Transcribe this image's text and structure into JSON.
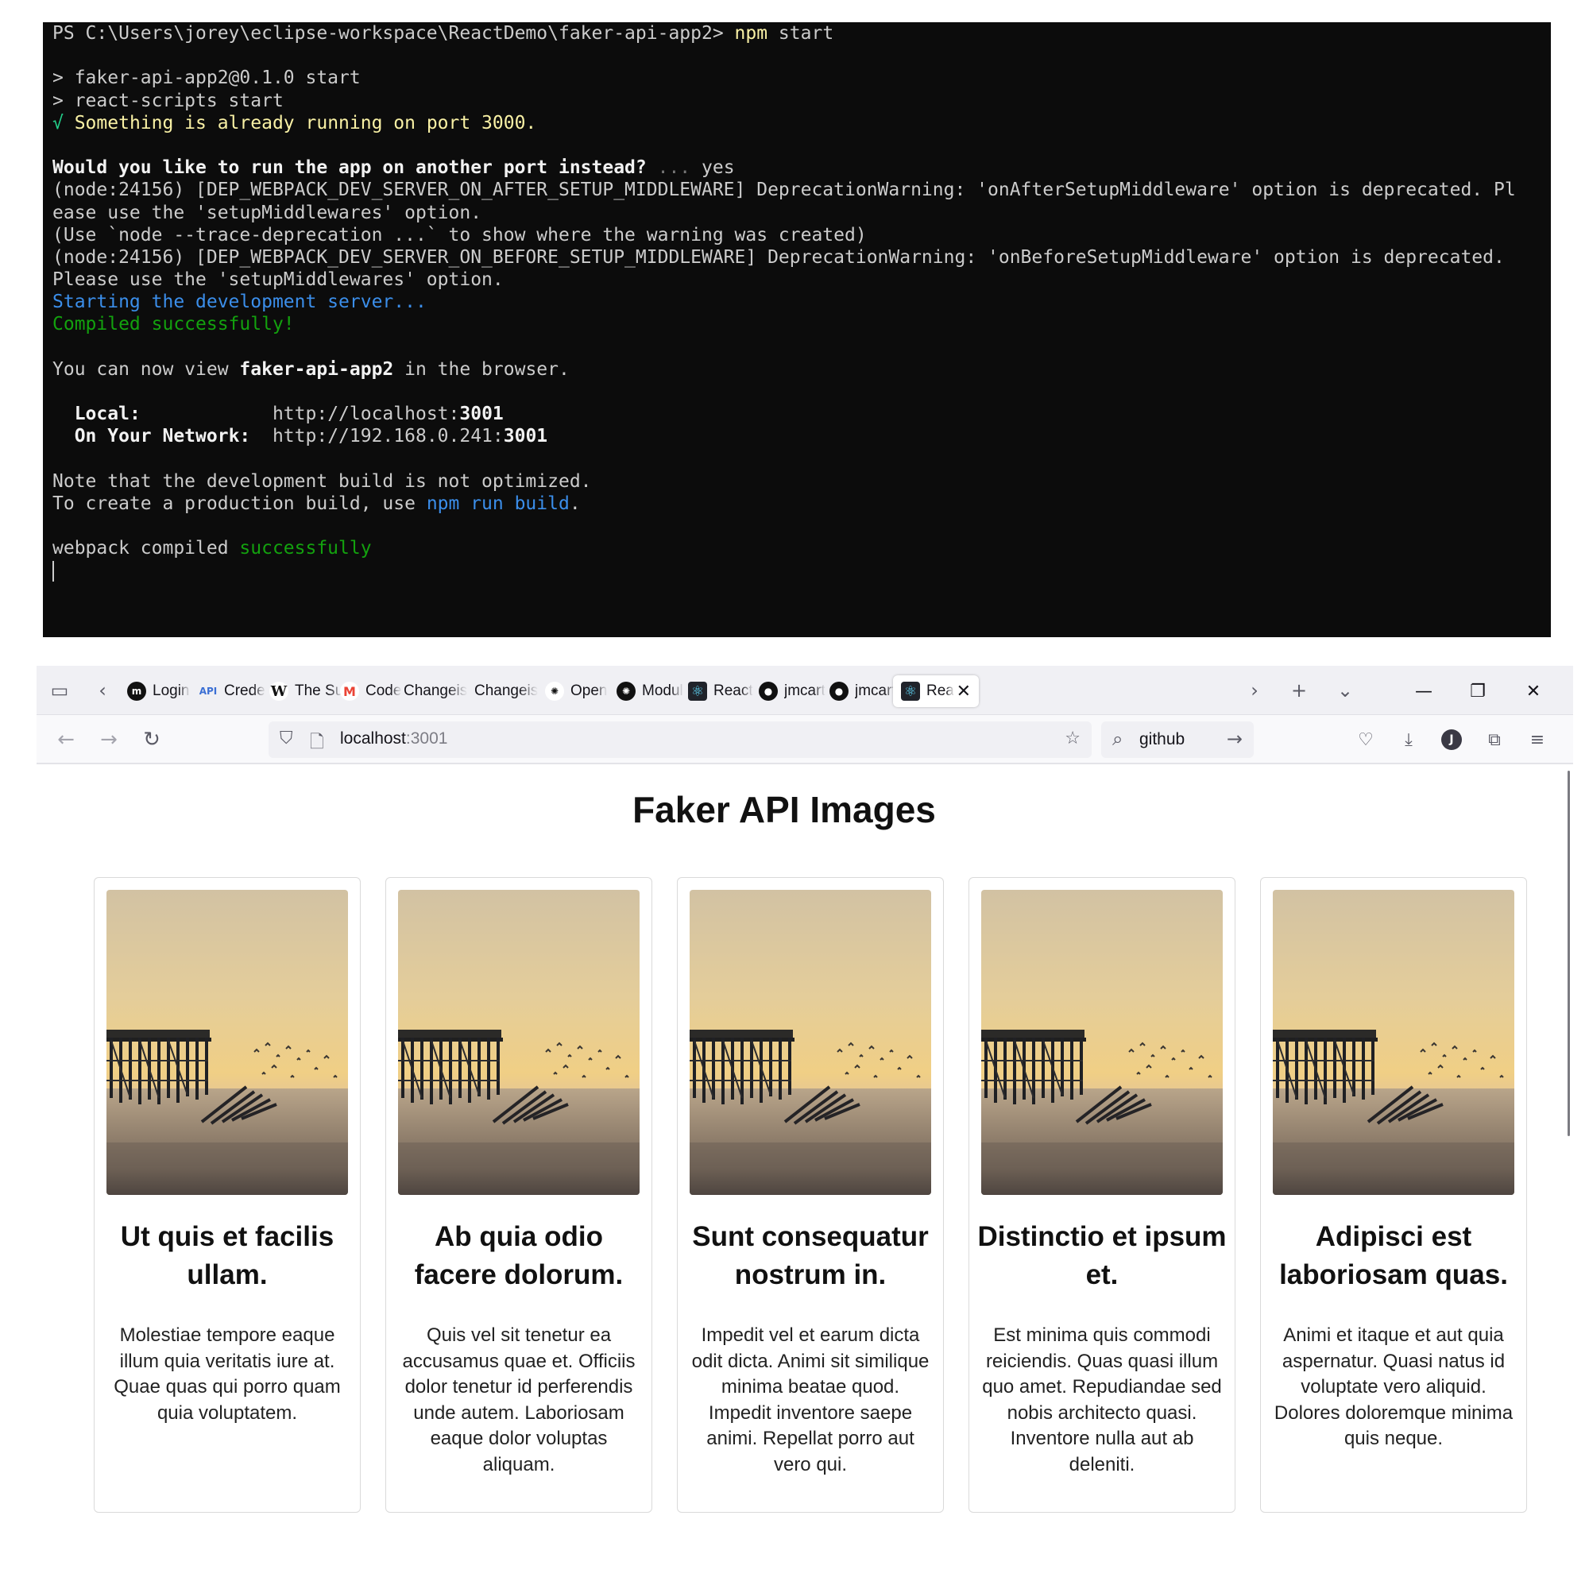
{
  "terminal": {
    "lines": [
      [
        {
          "t": "PS C:\\Users\\jorey\\eclipse-workspace\\ReactDemo\\faker-api-app2> "
        },
        {
          "t": "npm",
          "c": "c-yellow"
        },
        {
          "t": " start"
        }
      ],
      [],
      [
        {
          "t": "> faker-api-app2@0.1.0 start"
        }
      ],
      [
        {
          "t": "> react-scripts start"
        }
      ],
      [
        {
          "t": "√ ",
          "c": "c-green"
        },
        {
          "t": "Something is already running on port 3000.",
          "c": "c-yellow"
        }
      ],
      [],
      [
        {
          "t": "Would you like to run the app on another port instead?",
          "c": "c-white"
        },
        {
          "t": " ... ",
          "c": "c-dim"
        },
        {
          "t": "yes"
        }
      ],
      [
        {
          "t": "(node:24156) [DEP_WEBPACK_DEV_SERVER_ON_AFTER_SETUP_MIDDLEWARE] DeprecationWarning: 'onAfterSetupMiddleware' option is deprecated. Pl"
        }
      ],
      [
        {
          "t": "ease use the 'setupMiddlewares' option."
        }
      ],
      [
        {
          "t": "(Use `node --trace-deprecation ...` to show where the warning was created)"
        }
      ],
      [
        {
          "t": "(node:24156) [DEP_WEBPACK_DEV_SERVER_ON_BEFORE_SETUP_MIDDLEWARE] DeprecationWarning: 'onBeforeSetupMiddleware' option is deprecated."
        }
      ],
      [
        {
          "t": "Please use the 'setupMiddlewares' option."
        }
      ],
      [
        {
          "t": "Starting the development server...",
          "c": "c-blue"
        }
      ],
      [
        {
          "t": "Compiled successfully!",
          "c": "c-green2"
        }
      ],
      [],
      [
        {
          "t": "You can now view "
        },
        {
          "t": "faker-api-app2",
          "c": "c-white"
        },
        {
          "t": " in the browser."
        }
      ],
      [],
      [
        {
          "t": "  "
        },
        {
          "t": "Local:",
          "c": "c-white"
        },
        {
          "t": "            http://localhost:"
        },
        {
          "t": "3001",
          "c": "c-white"
        }
      ],
      [
        {
          "t": "  "
        },
        {
          "t": "On Your Network:",
          "c": "c-white"
        },
        {
          "t": "  http://192.168.0.241:"
        },
        {
          "t": "3001",
          "c": "c-white"
        }
      ],
      [],
      [
        {
          "t": "Note that the development build is not optimized."
        }
      ],
      [
        {
          "t": "To create a production build, use "
        },
        {
          "t": "npm run build",
          "c": "c-blue"
        },
        {
          "t": "."
        }
      ],
      [],
      [
        {
          "t": "webpack compiled "
        },
        {
          "t": "successfully",
          "c": "c-green2"
        }
      ]
    ]
  },
  "browser": {
    "tabs": [
      {
        "label": "Login",
        "icon": "m-logo-icon",
        "glyph": "m",
        "color": "#111111"
      },
      {
        "label": "Crede",
        "icon": "api-icon",
        "glyph": "API",
        "color": "#3b6fd4"
      },
      {
        "label": "The Su",
        "icon": "wikipedia-icon",
        "glyph": "W",
        "color": "#ffffff"
      },
      {
        "label": "Code",
        "icon": "gmail-icon",
        "glyph": "M",
        "color": "#ea4335"
      },
      {
        "label": "Changeis",
        "icon": "",
        "glyph": "",
        "color": ""
      },
      {
        "label": "Changeis",
        "icon": "",
        "glyph": "",
        "color": ""
      },
      {
        "label": "Open",
        "icon": "openai-icon",
        "glyph": "✺",
        "color": "#ffffff"
      },
      {
        "label": "Modul",
        "icon": "openai-icon",
        "glyph": "✺",
        "color": "#111111"
      },
      {
        "label": "React",
        "icon": "react-icon",
        "glyph": "⚛",
        "color": "#20232a"
      },
      {
        "label": "jmcart",
        "icon": "github-icon",
        "glyph": "●",
        "color": "#111111"
      },
      {
        "label": "jmcart",
        "icon": "github-icon",
        "glyph": "●",
        "color": "#111111"
      },
      {
        "label": "Rea",
        "icon": "react-icon",
        "glyph": "⚛",
        "color": "#20232a",
        "active": true
      }
    ],
    "url_host": "localhost",
    "url_port": ":3001",
    "search_text": "github"
  },
  "page": {
    "title": "Faker API Images",
    "cards": [
      {
        "title": "Ut quis et facilis ullam.",
        "body": "Molestiae tempore eaque illum quia veritatis iure at. Quae quas qui porro quam quia voluptatem."
      },
      {
        "title": "Ab quia odio facere dolorum.",
        "body": "Quis vel sit tenetur ea accusamus quae et. Officiis dolor tenetur id perferendis unde autem. Laboriosam eaque dolor voluptas aliquam."
      },
      {
        "title": "Sunt consequatur nostrum in.",
        "body": "Impedit vel et earum dicta odit dicta. Animi sit similique minima beatae quod. Impedit inventore saepe animi. Repellat porro aut vero qui."
      },
      {
        "title": "Distinctio et ipsum et.",
        "body": "Est minima quis commodi reiciendis. Quas quasi illum quo amet. Repudiandae sed nobis architecto quasi. Inventore nulla aut ab deleniti."
      },
      {
        "title": "Adipisci est laboriosam quas.",
        "body": "Animi et itaque et aut quia aspernatur. Quasi natus id voluptate vero aliquid. Dolores doloremque minima quis neque."
      }
    ]
  }
}
